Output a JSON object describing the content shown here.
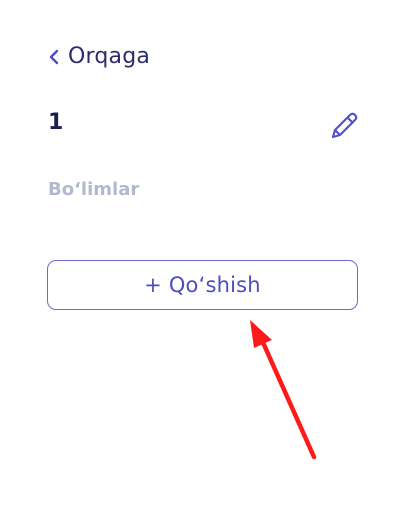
{
  "nav": {
    "back_label": "Orqaga",
    "back_icon": "chevron-left-icon"
  },
  "header": {
    "title": "1",
    "edit_icon": "pencil-icon"
  },
  "section": {
    "label": "Bo‘limlar"
  },
  "actions": {
    "add_label": "+ Qo‘shish"
  },
  "annotation": {
    "arrow_color": "#ff1a1a"
  },
  "colors": {
    "accent": "#4d4cc2",
    "text_dark": "#1d1f4d",
    "muted": "#b3b9cc"
  }
}
